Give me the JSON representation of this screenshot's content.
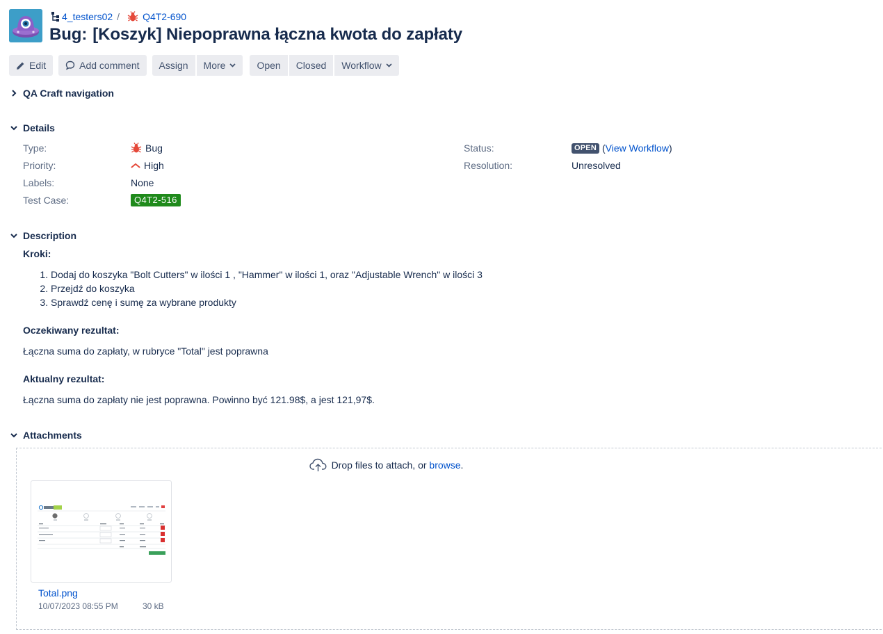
{
  "breadcrumb": {
    "project": "4_testers02",
    "separator": "/",
    "issue_key": "Q4T2-690"
  },
  "issue": {
    "type_prefix": "Bug:",
    "summary": "[Koszyk] Niepoprawna łączna kwota do zapłaty"
  },
  "toolbar": {
    "edit": "Edit",
    "add_comment": "Add comment",
    "assign": "Assign",
    "more": "More",
    "open": "Open",
    "closed": "Closed",
    "workflow": "Workflow"
  },
  "sections": {
    "qa_nav": "QA Craft navigation",
    "details": "Details",
    "description": "Description",
    "attachments": "Attachments"
  },
  "details": {
    "type_label": "Type:",
    "type_value": "Bug",
    "priority_label": "Priority:",
    "priority_value": "High",
    "labels_label": "Labels:",
    "labels_value": "None",
    "test_case_label": "Test Case:",
    "test_case_value": "Q4T2-516",
    "status_label": "Status:",
    "status_value": "OPEN",
    "view_workflow_open": "(",
    "view_workflow": "View Workflow",
    "view_workflow_close": ")",
    "resolution_label": "Resolution:",
    "resolution_value": "Unresolved"
  },
  "description": {
    "steps_heading": "Kroki:",
    "steps": [
      "Dodaj do koszyka \"Bolt Cutters\" w ilości 1 , \"Hammer\" w ilości 1, oraz \"Adjustable Wrench\" w ilości 3",
      "Przejdź do koszyka",
      "Sprawdź cenę i sumę za wybrane produkty"
    ],
    "expected_heading": "Oczekiwany rezultat:",
    "expected": "Łączna suma do zapłaty, w rubryce \"Total\" jest poprawna",
    "actual_heading": "Aktualny rezultat:",
    "actual": "Łączna suma do zapłaty nie jest poprawna. Powinno być 121.98$, a jest 121,97$."
  },
  "attachments": {
    "drop_text": "Drop files to attach, or ",
    "browse": "browse",
    "drop_end": ".",
    "file": {
      "name": "Total.png",
      "date": "10/07/2023 08:55 PM",
      "size": "30 kB"
    }
  },
  "colors": {
    "link": "#0052cc",
    "text": "#172b4d",
    "muted": "#5e6c84",
    "button_bg": "#ebecf0",
    "bug_red": "#e5493a",
    "status_lozenge": "#42526e",
    "test_case_green": "#1f8a1b"
  }
}
